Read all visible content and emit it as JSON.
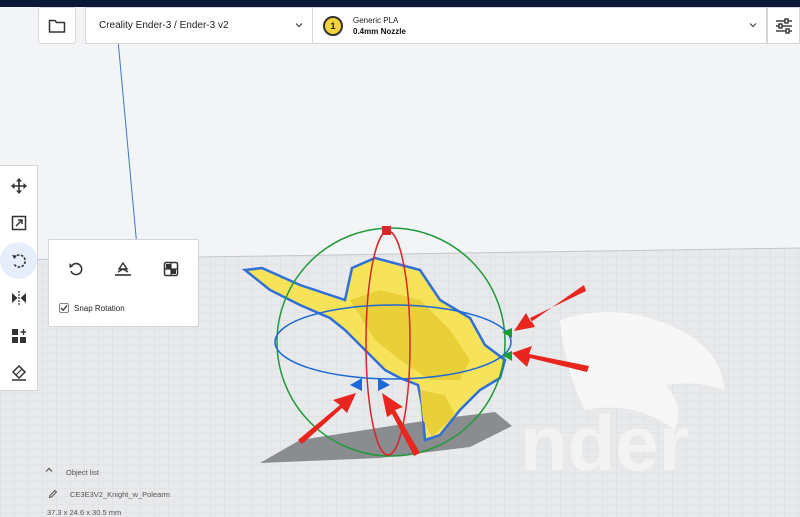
{
  "header": {
    "printer": "Creality Ender-3 / Ender-3 v2",
    "extruder_number": "1",
    "material": "Generic PLA",
    "nozzle": "0.4mm Nozzle"
  },
  "rotate_panel": {
    "snap_label": "Snap Rotation",
    "snap_checked": true
  },
  "object_list": {
    "label": "Object list",
    "object_name": "CE3E3V2_Knight_w_Polearm",
    "dimensions": "37.3 x 24.6 x 30.5 mm"
  },
  "colors": {
    "accent": "#196ef0",
    "header_bar": "#0b1835",
    "model": "#f7e35a",
    "rotate_x": "#d92628",
    "rotate_y": "#1f9a3a",
    "rotate_z": "#1c68d6",
    "annotation_arrow": "#e8251e"
  },
  "icons": {
    "open": "folder-icon",
    "settings": "sliders-icon",
    "tools": [
      "move-icon",
      "scale-icon",
      "rotate-icon",
      "mirror-icon",
      "per-model-settings-icon",
      "support-blocker-icon"
    ],
    "rotate_actions": [
      "reset-rotation-icon",
      "lay-flat-icon",
      "select-face-icon"
    ]
  }
}
